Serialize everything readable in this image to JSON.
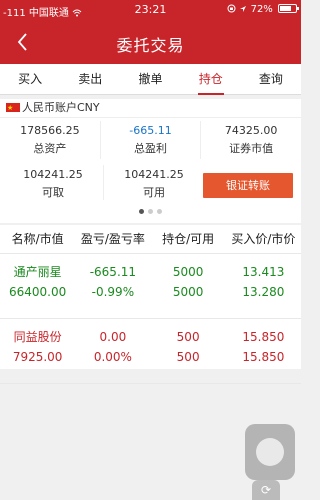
{
  "status_bar": {
    "signal": "-111",
    "carrier": "中国联通",
    "time": "23:21",
    "battery": "72%"
  },
  "header": {
    "title": "委托交易"
  },
  "tabs": [
    {
      "label": "买入"
    },
    {
      "label": "卖出"
    },
    {
      "label": "撤单"
    },
    {
      "label": "持仓"
    },
    {
      "label": "查询"
    }
  ],
  "account": {
    "label": "人民币账户CNY",
    "total_assets": {
      "value": "178566.25",
      "label": "总资产"
    },
    "total_profit": {
      "value": "-665.11",
      "label": "总盈利"
    },
    "market_value": {
      "value": "74325.00",
      "label": "证券市值"
    },
    "withdrawable": {
      "value": "104241.25",
      "label": "可取"
    },
    "available": {
      "value": "104241.25",
      "label": "可用"
    },
    "transfer_button": "银证转账"
  },
  "table": {
    "headers": [
      "名称/市值",
      "盈亏/盈亏率",
      "持仓/可用",
      "买入价/市价"
    ],
    "rows": [
      {
        "line1": [
          "通产丽星",
          "-665.11",
          "5000",
          "13.413"
        ],
        "line2": [
          "66400.00",
          "-0.99%",
          "5000",
          "13.280"
        ]
      },
      {
        "line1": [
          "同益股份",
          "0.00",
          "500",
          "15.850"
        ],
        "line2": [
          "7925.00",
          "0.00%",
          "500",
          "15.850"
        ]
      }
    ]
  },
  "colors": {
    "brand": "#c8252b",
    "profit_negative": "#1a8a1f",
    "button": "#e4572f"
  }
}
